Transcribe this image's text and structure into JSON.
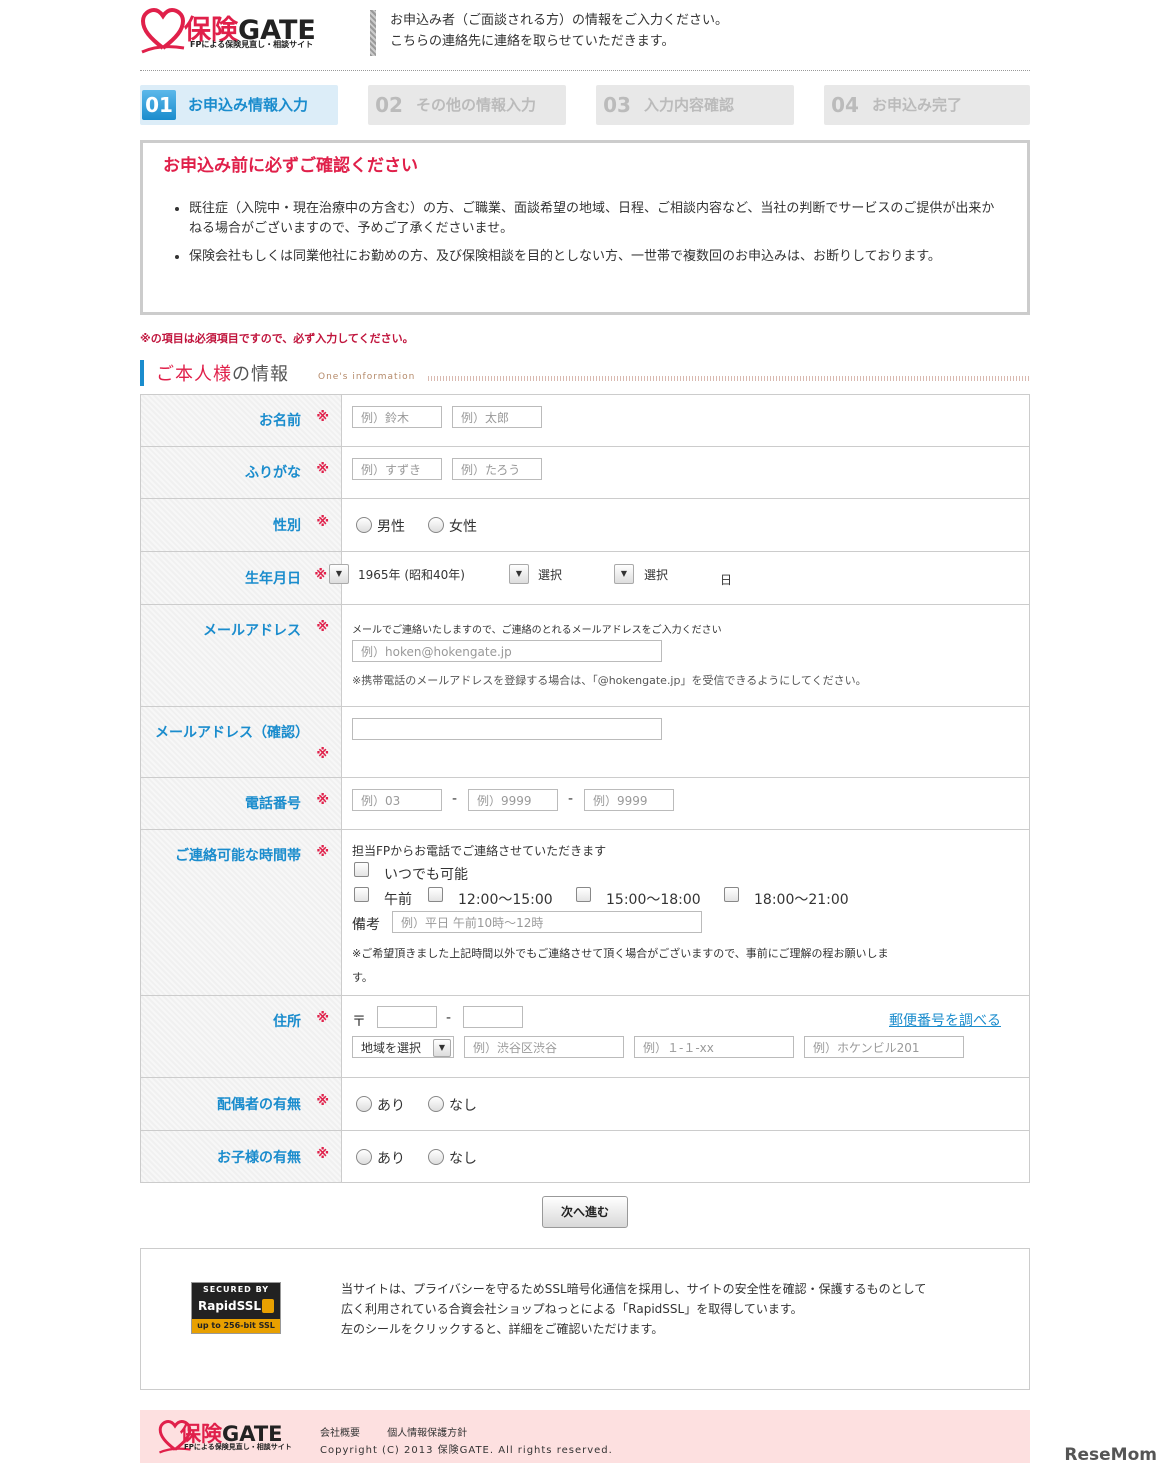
{
  "header": {
    "brand_main": "保険",
    "brand_gate": "GATE",
    "brand_sub": "FPによる保険見直し・相談サイト",
    "message_line1": "お申込み者（ご面談される方）の情報をご入力ください。",
    "message_line2": "こちらの連絡先に連絡を取らせていただきます。"
  },
  "steps": [
    {
      "num": "01",
      "label": "お申込み情報入力"
    },
    {
      "num": "02",
      "label": "その他の情報入力"
    },
    {
      "num": "03",
      "label": "入力内容確認"
    },
    {
      "num": "04",
      "label": "お申込み完了"
    }
  ],
  "notice": {
    "title": "お申込み前に必ずご確認ください",
    "items": [
      "既往症（入院中・現在治療中の方含む）の方、ご職業、面談希望の地域、日程、ご相談内容など、当社の判断でサービスのご提供が出来かねる場合がございますので、予めご了承くださいませ。",
      "保険会社もしくは同業他社にお勤めの方、及び保険相談を目的としない方、一世帯で複数回のお申込みは、お断りしております。"
    ]
  },
  "required_note": "※の項目は必須項目ですので、必ず入力してください。",
  "section": {
    "title_em": "ご本人様",
    "title_rest": "の情報",
    "title_en": "One's information"
  },
  "required_mark": "※",
  "form": {
    "name": {
      "label": "お名前",
      "last_placeholder": "例）鈴木",
      "first_placeholder": "例）太郎"
    },
    "furigana": {
      "label": "ふりがな",
      "last_placeholder": "例）すずき",
      "first_placeholder": "例）たろう"
    },
    "gender": {
      "label": "性別",
      "male": "男性",
      "female": "女性"
    },
    "birthday": {
      "label": "生年月日",
      "year": "1965年 (昭和40年)",
      "month": "選択",
      "day": "選択",
      "day_unit": "日"
    },
    "email": {
      "label": "メールアドレス",
      "note": "メールでご連絡いたしますので、ご連絡のとれるメールアドレスをご入力ください",
      "placeholder": "例）hoken@hokengate.jp",
      "help": "※携帯電話のメールアドレスを登録する場合は、「@hokengate.jp」を受信できるようにしてください。"
    },
    "email_confirm": {
      "label": "メールアドレス（確認）"
    },
    "phone": {
      "label": "電話番号",
      "p1": "例）03",
      "p2": "例）9999",
      "p3": "例）9999",
      "sep": "-"
    },
    "contact_time": {
      "label": "ご連絡可能な時間帯",
      "intro": "担当FPからお電話でご連絡させていただきます",
      "anytime": "いつでも可能",
      "morning": "午前",
      "slot1": "12:00〜15:00",
      "slot2": "15:00〜18:00",
      "slot3": "18:00〜21:00",
      "remarks_label": "備考",
      "remarks_placeholder": "例）平日 午前10時〜12時",
      "note_line1": "※ご希望頂きました上記時間以外でもご連絡させて頂く場合がございますので、事前にご理解の程お願いしま",
      "note_line2": "す。"
    },
    "address": {
      "label": "住所",
      "postal_mark": "〒",
      "sep": "-",
      "lookup_link": "郵便番号を調べる",
      "region": "地域を選択",
      "city_placeholder": "例）渋谷区渋谷",
      "street_placeholder": "例）１-１-xx",
      "building_placeholder": "例）ホケンビル201"
    },
    "spouse": {
      "label": "配偶者の有無",
      "yes": "あり",
      "no": "なし"
    },
    "children": {
      "label": "お子様の有無",
      "yes": "あり",
      "no": "なし"
    }
  },
  "next_button": "次へ進む",
  "ssl": {
    "seal_top": "SECURED BY",
    "seal_brand": "RapidSSL.",
    "seal_bottom": "up to 256-bit SSL",
    "line1": "当サイトは、プライバシーを守るためSSL暗号化通信を採用し、サイトの安全性を確認・保護するものとして",
    "line2": "広く利用されている合資会社ショップねっとによる「RapidSSL」を取得しています。",
    "line3": "左のシールをクリックすると、詳細をご確認いただけます。"
  },
  "footer": {
    "link_company": "会社概要",
    "link_privacy": "個人情報保護方針",
    "copyright": "Copyright (C) 2013 保険GATE. All rights reserved."
  },
  "watermark": "ReseMom",
  "colors": {
    "brand_pink": "#e0204a",
    "accent_blue": "#1a8ccd",
    "footer_bg": "#fde0e0"
  }
}
